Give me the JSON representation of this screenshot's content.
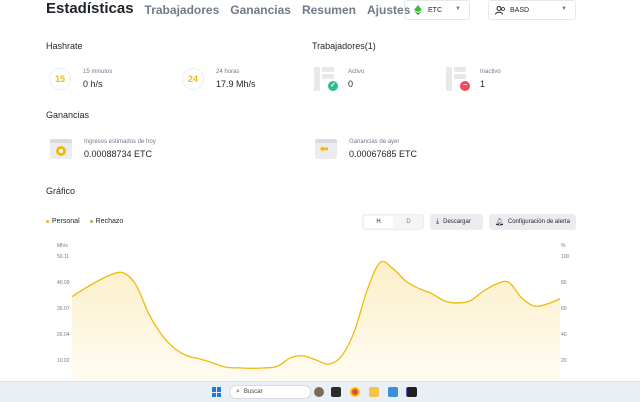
{
  "nav": {
    "active": "Estadísticas",
    "tabs": [
      "Trabajadores",
      "Ganancias",
      "Resumen",
      "Ajustes"
    ]
  },
  "coin_select": {
    "value": "ETC",
    "icon": "ethereum-classic-icon"
  },
  "account_select": {
    "value": "BASD",
    "icon": "users-icon"
  },
  "hashrate": {
    "title": "Hashrate",
    "items": [
      {
        "badge": "15",
        "label": "15 minutos",
        "value": "0 h/s"
      },
      {
        "badge": "24",
        "label": "24 horas",
        "value": "17.9 Mh/s"
      }
    ]
  },
  "workers": {
    "title": "Trabajadores(1)",
    "items": [
      {
        "label": "Activo",
        "value": "0",
        "status": "active"
      },
      {
        "label": "Inactivo",
        "value": "1",
        "status": "inactive"
      }
    ]
  },
  "earnings": {
    "title": "Ganancias",
    "items": [
      {
        "label": "Ingresos estimados de hoy",
        "value": "0.00088734 ETC"
      },
      {
        "label": "Ganancias de ayer",
        "value": "0.00067685 ETC"
      }
    ]
  },
  "chart_section": {
    "title": "Gráfico",
    "legend": [
      {
        "label": "Personal",
        "color": "#f0b90b"
      },
      {
        "label": "Rechazo",
        "color": "#8bc34a"
      }
    ],
    "toggle": [
      "H",
      "D"
    ],
    "toggle_selected": "H",
    "download_label": "Descargar",
    "alert_label": "Configuración de alerta"
  },
  "colors": {
    "accent": "#f0b90b",
    "success": "#2ebd85",
    "danger": "#f6465d"
  },
  "chart_data": {
    "type": "area",
    "ylabel_left": "Mh/s",
    "ylabel_right": "%",
    "left_ticks": [
      "50.11",
      "40.09",
      "30.07",
      "20.04",
      "10.02"
    ],
    "right_ticks": [
      "100",
      "80",
      "60",
      "40",
      "20"
    ],
    "ylim_left": [
      0,
      50.11
    ],
    "ylim_right": [
      0,
      100
    ],
    "series": [
      {
        "name": "Personal",
        "values": [
          30.5,
          34.5,
          38.0,
          41.0,
          42.0,
          36.0,
          22.0,
          12.0,
          5.5,
          2.0,
          0.5,
          -1.5,
          -3.5,
          -3.8,
          -4.0,
          -3.8,
          -3.0,
          1.0,
          2.0,
          0.0,
          -2.0,
          2.0,
          14.0,
          34.0,
          47.0,
          44.0,
          38.0,
          34.5,
          32.0,
          28.5,
          27.5,
          28.5,
          33.0,
          36.5,
          37.5,
          30.0,
          26.0,
          27.0,
          29.5
        ]
      }
    ]
  },
  "taskbar": {
    "search_placeholder": "Buscar",
    "apps": [
      "windows-start-icon",
      "chrome-icon",
      "file-explorer-icon",
      "teams-icon",
      "terminal-icon"
    ]
  }
}
